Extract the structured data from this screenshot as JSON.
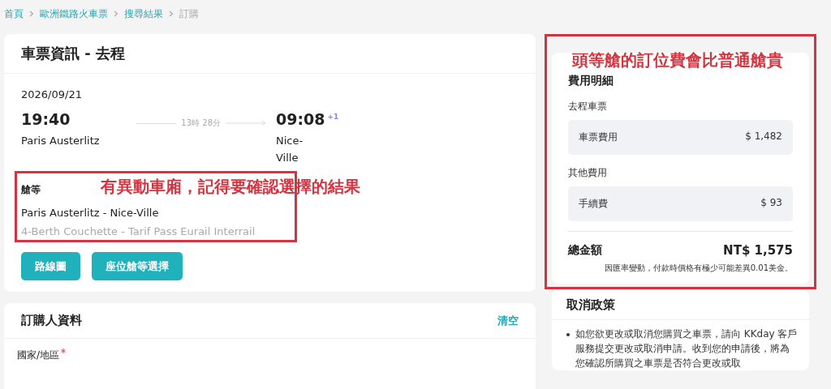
{
  "breadcrumb": [
    {
      "label": "首頁",
      "current": false
    },
    {
      "label": "歐洲鐵路火車票",
      "current": false
    },
    {
      "label": "搜尋結果",
      "current": false
    },
    {
      "label": "訂購",
      "current": true
    }
  ],
  "ticket": {
    "title": "車票資訊 - 去程",
    "date": "2026/09/21",
    "depart_time": "19:40",
    "depart_station": "Paris Austerlitz",
    "duration": "13時 28分",
    "arrive_time": "09:08",
    "day_offset": "+1",
    "arrive_station": "Nice-Ville",
    "class_label": "艙等",
    "route": "Paris Austerlitz - Nice-Ville",
    "fare": "4-Berth Couchette - Tarif Pass Eurail Interrail",
    "buttons": [
      "路線圖",
      "座位艙等選擇"
    ]
  },
  "annotations": [
    {
      "text": "有異動車廂，記得要確認選擇的結果"
    },
    {
      "text": "頭等艙的訂位費會比普通艙貴"
    }
  ],
  "booker": {
    "title": "訂購人資料",
    "clear": "清空",
    "field_label": "國家/地區",
    "required": true
  },
  "fees": {
    "title": "費用明細",
    "groups": [
      {
        "label": "去程車票",
        "items": [
          {
            "name": "車票費用",
            "amount": "$ 1,482"
          }
        ]
      },
      {
        "label": "其他費用",
        "items": [
          {
            "name": "手續費",
            "amount": "$ 93"
          }
        ]
      }
    ],
    "total_label": "總金額",
    "total": "NT$ 1,575",
    "note": "因匯率變動，付款時價格有極少可能差異0.01美金。"
  },
  "policy": {
    "title": "取消政策",
    "items": [
      "如您欲更改或取消您購買之車票，請向 KKday 客戶服務提交更改或取消申請。收到您的申請後，將為您確認所購買之車票是否符合更改或取"
    ]
  }
}
